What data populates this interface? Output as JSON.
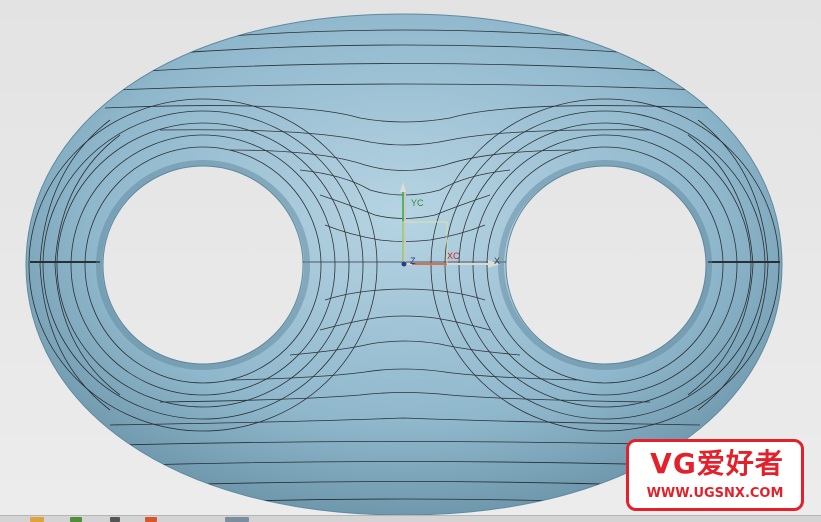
{
  "viewport": {
    "model": "chain-link-shackle",
    "surface_color": "#9ec2d6",
    "background_color": "#e6e6e6",
    "triad": {
      "yc_label": "YC",
      "xc_label": "XC",
      "zc_label": "Z",
      "x_label": "X"
    }
  },
  "watermark": {
    "title": "VG爱好者",
    "url": "WWW.UGSNX.COM",
    "color": "#e4212b"
  },
  "taskbar": {
    "items": [
      {
        "icon": "folder-icon",
        "color": "#e0a23a"
      },
      {
        "icon": "app-icon",
        "color": "#4f8f3a"
      },
      {
        "icon": "window-icon",
        "color": "#555555"
      },
      {
        "icon": "ug-icon",
        "color": "#d9552b"
      },
      {
        "icon": "window-icon",
        "color": "#7a8ea0"
      }
    ]
  }
}
